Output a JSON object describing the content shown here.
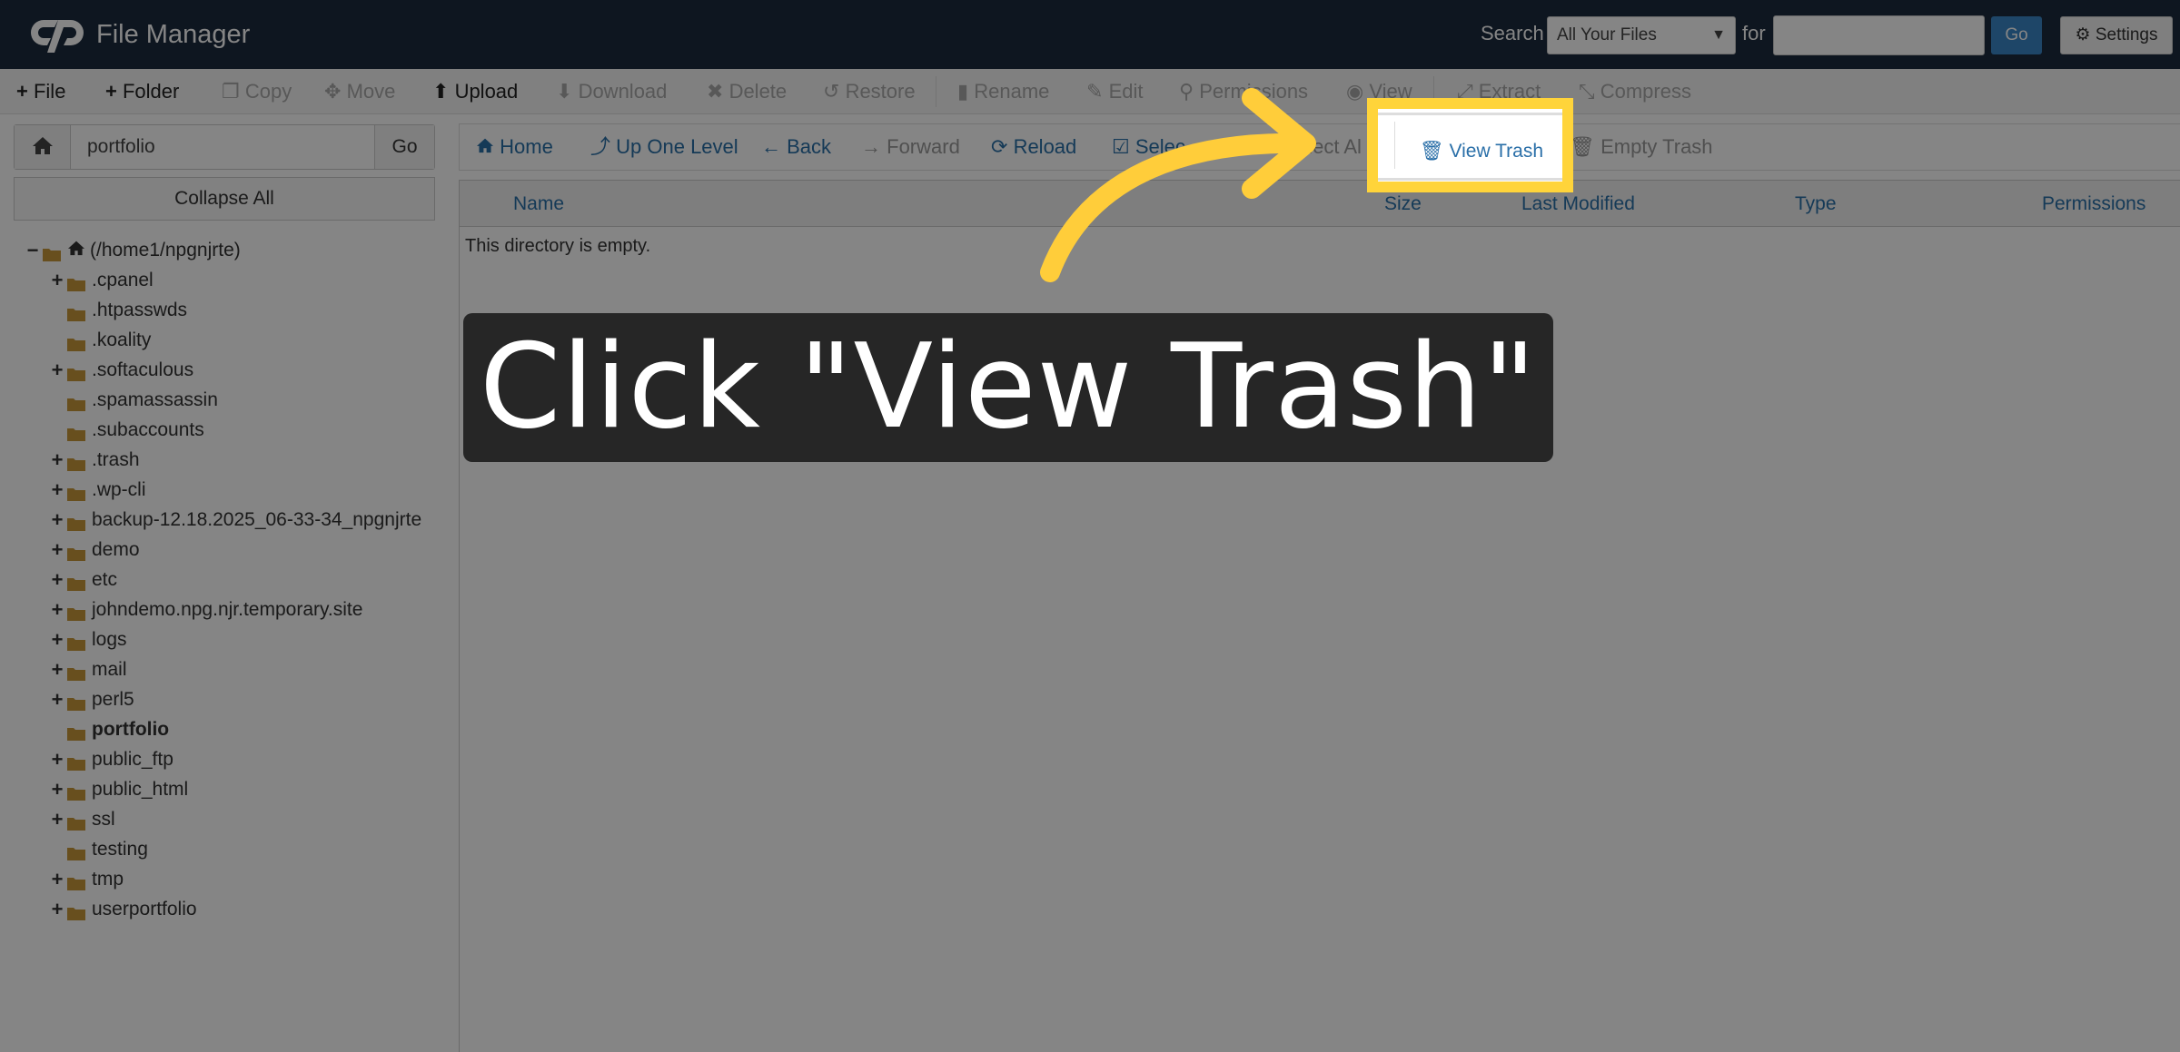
{
  "header": {
    "app_title": "File Manager",
    "search_label": "Search",
    "search_scope": "All Your Files",
    "for_label": "for",
    "search_value": "",
    "go_label": "Go",
    "settings_label": "Settings"
  },
  "toolbar": {
    "items": [
      {
        "label": "File",
        "icon": "plus-icon",
        "enabled": true
      },
      {
        "label": "Folder",
        "icon": "plus-icon",
        "enabled": true
      },
      {
        "label": "Copy",
        "icon": "copy-icon",
        "enabled": false
      },
      {
        "label": "Move",
        "icon": "move-icon",
        "enabled": false
      },
      {
        "label": "Upload",
        "icon": "upload-icon",
        "enabled": true
      },
      {
        "label": "Download",
        "icon": "download-icon",
        "enabled": false
      },
      {
        "label": "Delete",
        "icon": "delete-icon",
        "enabled": false
      },
      {
        "label": "Restore",
        "icon": "restore-icon",
        "enabled": false
      },
      {
        "label": "Rename",
        "icon": "file-icon",
        "enabled": false
      },
      {
        "label": "Edit",
        "icon": "pencil-icon",
        "enabled": false
      },
      {
        "label": "Permissions",
        "icon": "key-icon",
        "enabled": false
      },
      {
        "label": "View",
        "icon": "eye-icon",
        "enabled": false
      },
      {
        "label": "Extract",
        "icon": "expand-icon",
        "enabled": false
      },
      {
        "label": "Compress",
        "icon": "compress-icon",
        "enabled": false
      }
    ]
  },
  "left_panel": {
    "path_value": "portfolio",
    "go_label": "Go",
    "collapse_label": "Collapse All",
    "tree": [
      {
        "label": "(/home1/npgnjrte)",
        "expander": "−",
        "level": 0,
        "root": true
      },
      {
        "label": ".cpanel",
        "expander": "+",
        "level": 1
      },
      {
        "label": ".htpasswds",
        "expander": "",
        "level": 1
      },
      {
        "label": ".koality",
        "expander": "",
        "level": 1
      },
      {
        "label": ".softaculous",
        "expander": "+",
        "level": 1
      },
      {
        "label": ".spamassassin",
        "expander": "",
        "level": 1
      },
      {
        "label": ".subaccounts",
        "expander": "",
        "level": 1
      },
      {
        "label": ".trash",
        "expander": "+",
        "level": 1
      },
      {
        "label": ".wp-cli",
        "expander": "+",
        "level": 1
      },
      {
        "label": "backup-12.18.2025_06-33-34_npgnjrte",
        "expander": "+",
        "level": 1
      },
      {
        "label": "demo",
        "expander": "+",
        "level": 1
      },
      {
        "label": "etc",
        "expander": "+",
        "level": 1
      },
      {
        "label": "johndemo.npg.njr.temporary.site",
        "expander": "+",
        "level": 1
      },
      {
        "label": "logs",
        "expander": "+",
        "level": 1
      },
      {
        "label": "mail",
        "expander": "+",
        "level": 1
      },
      {
        "label": "perl5",
        "expander": "+",
        "level": 1
      },
      {
        "label": "portfolio",
        "expander": "",
        "level": 1,
        "selected": true
      },
      {
        "label": "public_ftp",
        "expander": "+",
        "level": 1
      },
      {
        "label": "public_html",
        "expander": "+",
        "level": 1
      },
      {
        "label": "ssl",
        "expander": "+",
        "level": 1
      },
      {
        "label": "testing",
        "expander": "",
        "level": 1
      },
      {
        "label": "tmp",
        "expander": "+",
        "level": 1
      },
      {
        "label": "userportfolio",
        "expander": "+",
        "level": 1
      }
    ]
  },
  "nav_bar": {
    "home": "Home",
    "up": "Up One Level",
    "back": "Back",
    "forward": "Forward",
    "reload": "Reload",
    "select_all_partial": "Selec",
    "unselect_all_partial": "elect Al",
    "view_trash": "View Trash",
    "empty_trash": "Empty Trash"
  },
  "table": {
    "columns": [
      "Name",
      "Size",
      "Last Modified",
      "Type",
      "Permissions"
    ],
    "empty_message": "This directory is empty."
  },
  "overlay": {
    "instruction": "Click \"View Trash\"",
    "highlight_label": "View Trash",
    "highlight_color": "#ffd43a"
  },
  "colors": {
    "header_bg": "#1c2b3e",
    "link_blue": "#2a6fa8",
    "go_blue": "#3a86c8",
    "folder": "#c8973a"
  }
}
